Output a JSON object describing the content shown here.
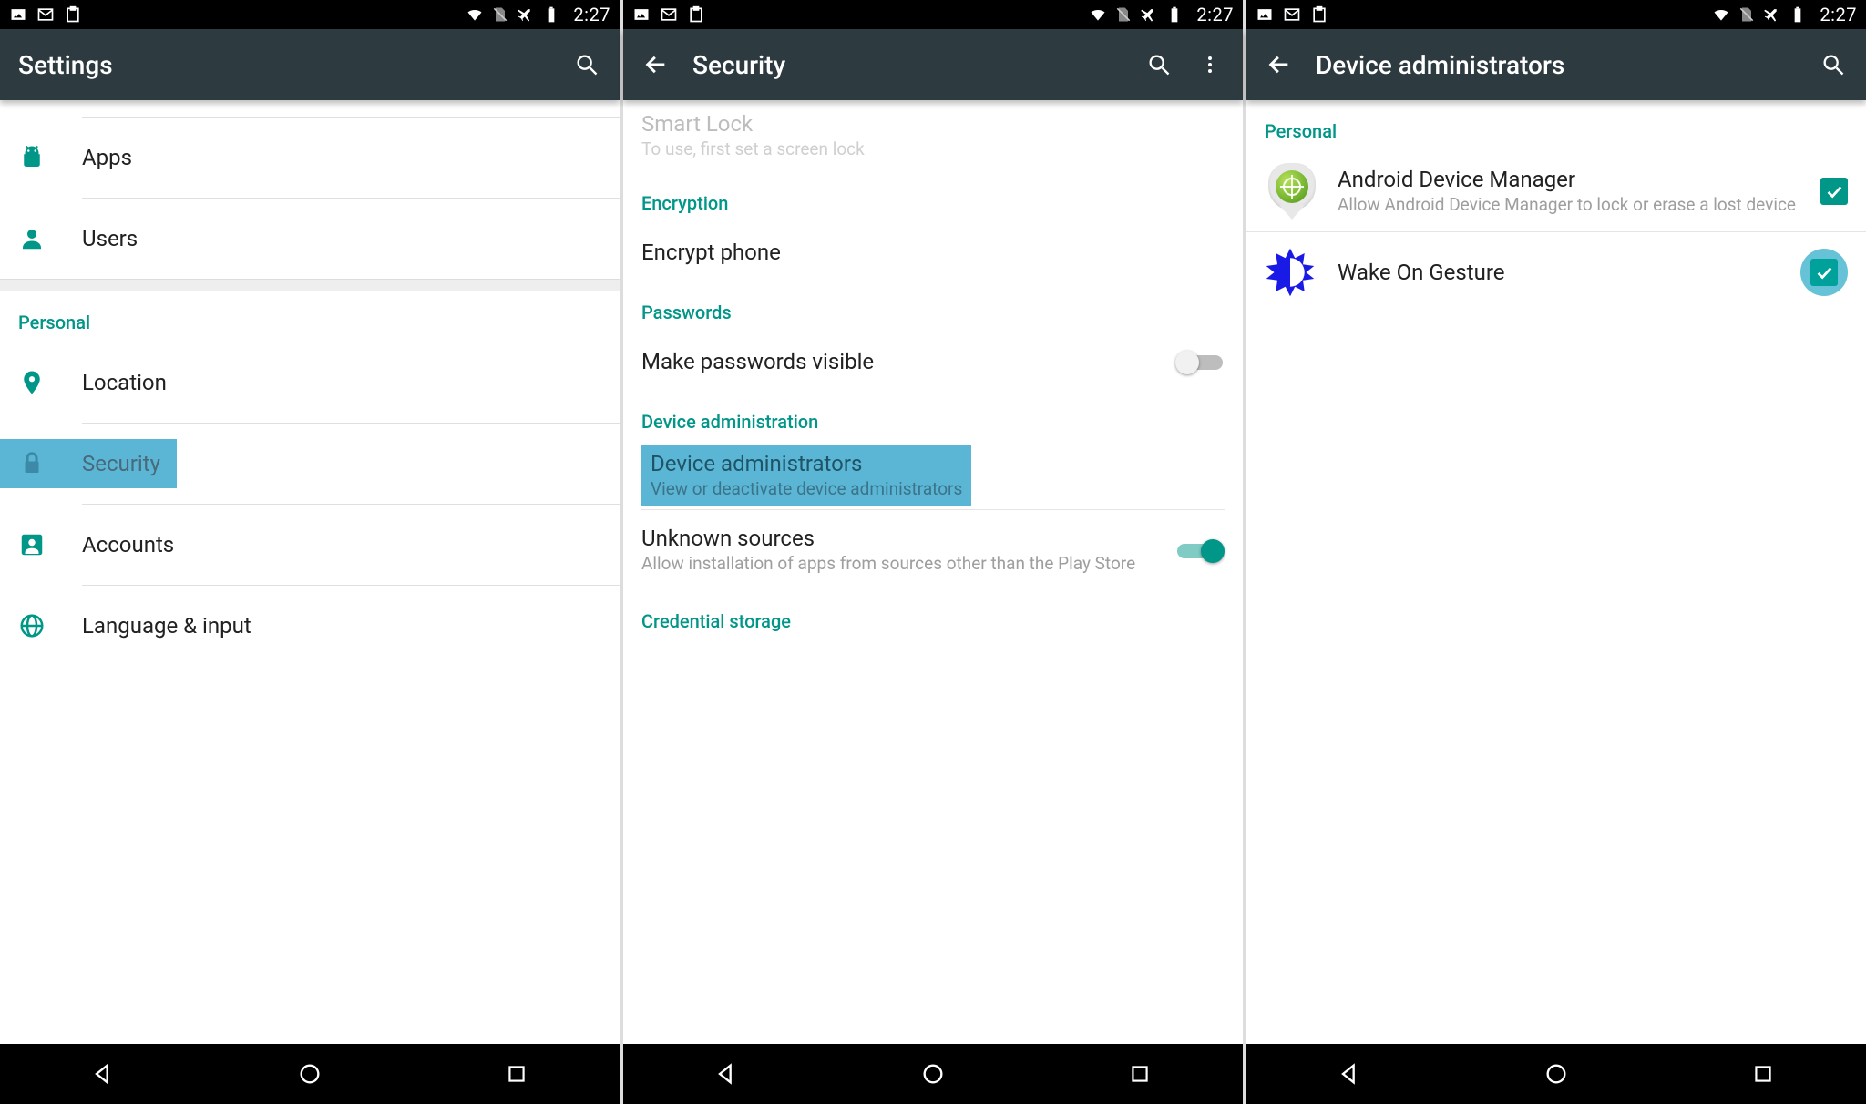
{
  "status": {
    "time": "2:27"
  },
  "screen1": {
    "title": "Settings",
    "items": {
      "apps": "Apps",
      "users": "Users"
    },
    "personal_header": "Personal",
    "personal": {
      "location": "Location",
      "security": "Security",
      "accounts": "Accounts",
      "language": "Language & input"
    }
  },
  "screen2": {
    "title": "Security",
    "smartlock": {
      "title": "Smart Lock",
      "sub": "To use, first set a screen lock"
    },
    "encryption_header": "Encryption",
    "encrypt_phone": "Encrypt phone",
    "passwords_header": "Passwords",
    "make_pw_visible": "Make passwords visible",
    "device_admin_header": "Device administration",
    "device_admins": {
      "title": "Device administrators",
      "sub": "View or deactivate device administrators"
    },
    "unknown_sources": {
      "title": "Unknown sources",
      "sub": "Allow installation of apps from sources other than the Play Store"
    },
    "credential_header": "Credential storage"
  },
  "screen3": {
    "title": "Device administrators",
    "personal_header": "Personal",
    "adm": {
      "title": "Android Device Manager",
      "sub": "Allow Android Device Manager to lock or erase a lost device"
    },
    "wake": {
      "title": "Wake On Gesture"
    }
  }
}
